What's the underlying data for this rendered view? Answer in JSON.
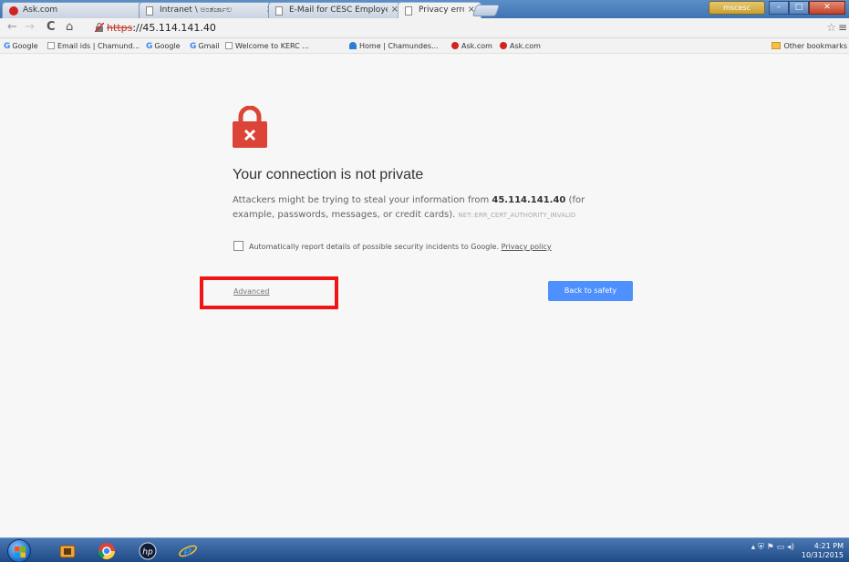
{
  "tabs": [
    {
      "label": "Ask.com",
      "icon": "ask-logo-icon",
      "close": "×",
      "active": false
    },
    {
      "label": "Intranet \\ ಅಂತರ್ಜಾಲ",
      "icon": "page-icon",
      "close": "×",
      "active": false
    },
    {
      "label": "E-Mail for CESC Employee",
      "icon": "page-icon",
      "close": "×",
      "active": false
    },
    {
      "label": "Privacy error",
      "icon": "page-icon",
      "close": "×",
      "active": true
    }
  ],
  "window": {
    "profile_label": "mscesc",
    "minimize": "–",
    "maximize": "□",
    "close": "✕"
  },
  "toolbar": {
    "back": "←",
    "forward": "→",
    "reload": "C",
    "home": "⌂",
    "url_scheme": "https",
    "url_rest": "://45.114.141.40",
    "star": "☆",
    "menu": "≡"
  },
  "bookmarks": {
    "items": [
      {
        "label": "Google",
        "icon": "google-icon"
      },
      {
        "label": "Email ids | Chamund...",
        "icon": "page-icon"
      },
      {
        "label": "Google",
        "icon": "google-icon"
      },
      {
        "label": "Gmail",
        "icon": "google-icon"
      },
      {
        "label": "Welcome to KERC ...",
        "icon": "page-icon"
      },
      {
        "label": "Home | Chamundes...",
        "icon": "home-icon"
      },
      {
        "label": "Ask.com",
        "icon": "ask-logo-icon"
      },
      {
        "label": "Ask.com",
        "icon": "ask-logo-icon"
      }
    ],
    "other": "Other bookmarks"
  },
  "error": {
    "heading": "Your connection is not private",
    "text_before": "Attackers might be trying to steal your information from ",
    "host": "45.114.141.40",
    "text_after": " (for example, passwords, messages, or credit cards).",
    "code": "NET::ERR_CERT_AUTHORITY_INVALID",
    "report_text": "Automatically report details of possible security incidents to Google.",
    "privacy_link": "Privacy policy",
    "advanced_label": "Advanced",
    "safety_button": "Back to safety",
    "highlight_color": "#f01515",
    "button_color": "#4d90fe"
  },
  "taskbar": {
    "apps": [
      "windows-explorer-icon",
      "chrome-icon",
      "hp-icon",
      "internet-explorer-icon"
    ],
    "tray": "▴ ⛨ ⚑ ▭ ◂)",
    "time": "4:21 PM",
    "date": "10/31/2015"
  }
}
